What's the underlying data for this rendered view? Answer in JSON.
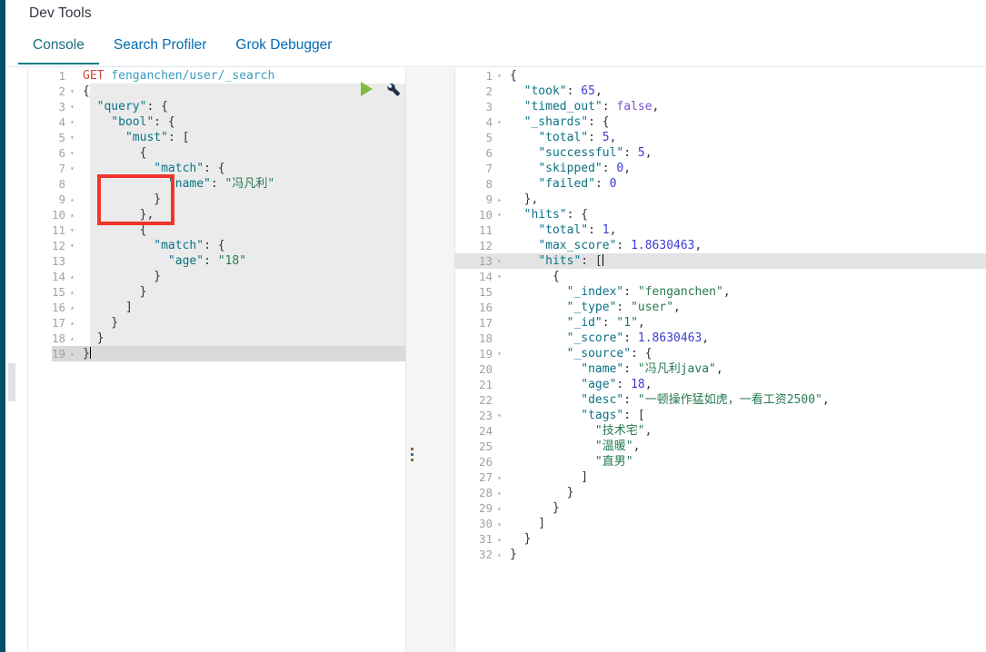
{
  "header": {
    "app_title": "Dev Tools",
    "tabs": [
      {
        "label": "Console",
        "active": true
      },
      {
        "label": "Search Profiler",
        "active": false
      },
      {
        "label": "Grok Debugger",
        "active": false
      }
    ]
  },
  "toolbar": {
    "run_icon": "play-icon",
    "wrench_icon": "wrench-icon"
  },
  "annotation": {
    "shape": "rectangle",
    "color": "#f2352c",
    "covers_lines": [
      3,
      4,
      5
    ]
  },
  "colors": {
    "rail": "#014f66",
    "tab_active_underline": "#017d87",
    "tab_link": "#006bb4",
    "editor_band": "#ebebeb",
    "active_line_left": "#d9d9d9",
    "active_line_right": "#e3e3e3",
    "key": "#0b7285",
    "string": "#267a52",
    "number": "#3b3bd4",
    "boolean": "#7a52d6",
    "method": "#d0463c",
    "url": "#3a9bbf",
    "play": "#7fbd42"
  },
  "request_editor": {
    "name": "console-request-editor",
    "active_line": 19,
    "lines": [
      {
        "n": 1,
        "fold": "",
        "tokens": [
          {
            "t": "GET ",
            "c": "method"
          },
          {
            "t": "fenganchen/user/_search",
            "c": "url"
          }
        ]
      },
      {
        "n": 2,
        "fold": "▾",
        "tokens": [
          {
            "t": "{",
            "c": "p"
          }
        ]
      },
      {
        "n": 3,
        "fold": "▾",
        "tokens": [
          {
            "t": "  ",
            "c": "p"
          },
          {
            "t": "\"query\"",
            "c": "k"
          },
          {
            "t": ": {",
            "c": "p"
          }
        ]
      },
      {
        "n": 4,
        "fold": "▾",
        "tokens": [
          {
            "t": "    ",
            "c": "p"
          },
          {
            "t": "\"bool\"",
            "c": "k"
          },
          {
            "t": ": {",
            "c": "p"
          }
        ]
      },
      {
        "n": 5,
        "fold": "▾",
        "tokens": [
          {
            "t": "      ",
            "c": "p"
          },
          {
            "t": "\"must\"",
            "c": "k"
          },
          {
            "t": ": [",
            "c": "p"
          }
        ]
      },
      {
        "n": 6,
        "fold": "▾",
        "tokens": [
          {
            "t": "        {",
            "c": "p"
          }
        ]
      },
      {
        "n": 7,
        "fold": "▾",
        "tokens": [
          {
            "t": "          ",
            "c": "p"
          },
          {
            "t": "\"match\"",
            "c": "k"
          },
          {
            "t": ": {",
            "c": "p"
          }
        ]
      },
      {
        "n": 8,
        "fold": "",
        "tokens": [
          {
            "t": "            ",
            "c": "p"
          },
          {
            "t": "\"name\"",
            "c": "k"
          },
          {
            "t": ": ",
            "c": "p"
          },
          {
            "t": "\"冯凡利\"",
            "c": "s"
          }
        ]
      },
      {
        "n": 9,
        "fold": "▴",
        "tokens": [
          {
            "t": "          }",
            "c": "p"
          }
        ]
      },
      {
        "n": 10,
        "fold": "▴",
        "tokens": [
          {
            "t": "        },",
            "c": "p"
          }
        ]
      },
      {
        "n": 11,
        "fold": "▾",
        "tokens": [
          {
            "t": "        {",
            "c": "p"
          }
        ]
      },
      {
        "n": 12,
        "fold": "▾",
        "tokens": [
          {
            "t": "          ",
            "c": "p"
          },
          {
            "t": "\"match\"",
            "c": "k"
          },
          {
            "t": ": {",
            "c": "p"
          }
        ]
      },
      {
        "n": 13,
        "fold": "",
        "tokens": [
          {
            "t": "            ",
            "c": "p"
          },
          {
            "t": "\"age\"",
            "c": "k"
          },
          {
            "t": ": ",
            "c": "p"
          },
          {
            "t": "\"18\"",
            "c": "s"
          }
        ]
      },
      {
        "n": 14,
        "fold": "▴",
        "tokens": [
          {
            "t": "          }",
            "c": "p"
          }
        ]
      },
      {
        "n": 15,
        "fold": "▴",
        "tokens": [
          {
            "t": "        }",
            "c": "p"
          }
        ]
      },
      {
        "n": 16,
        "fold": "▴",
        "tokens": [
          {
            "t": "      ]",
            "c": "p"
          }
        ]
      },
      {
        "n": 17,
        "fold": "▴",
        "tokens": [
          {
            "t": "    }",
            "c": "p"
          }
        ]
      },
      {
        "n": 18,
        "fold": "▴",
        "tokens": [
          {
            "t": "  }",
            "c": "p"
          }
        ]
      },
      {
        "n": 19,
        "fold": "▴",
        "tokens": [
          {
            "t": "}",
            "c": "p"
          }
        ],
        "caret": true
      }
    ]
  },
  "response_editor": {
    "name": "console-response-viewer",
    "active_line": 13,
    "lines": [
      {
        "n": 1,
        "fold": "▾",
        "tokens": [
          {
            "t": "{",
            "c": "p"
          }
        ]
      },
      {
        "n": 2,
        "fold": "",
        "tokens": [
          {
            "t": "  ",
            "c": "p"
          },
          {
            "t": "\"took\"",
            "c": "k"
          },
          {
            "t": ": ",
            "c": "p"
          },
          {
            "t": "65",
            "c": "n"
          },
          {
            "t": ",",
            "c": "p"
          }
        ]
      },
      {
        "n": 3,
        "fold": "",
        "tokens": [
          {
            "t": "  ",
            "c": "p"
          },
          {
            "t": "\"timed_out\"",
            "c": "k"
          },
          {
            "t": ": ",
            "c": "p"
          },
          {
            "t": "false",
            "c": "b"
          },
          {
            "t": ",",
            "c": "p"
          }
        ]
      },
      {
        "n": 4,
        "fold": "▾",
        "tokens": [
          {
            "t": "  ",
            "c": "p"
          },
          {
            "t": "\"_shards\"",
            "c": "k"
          },
          {
            "t": ": {",
            "c": "p"
          }
        ]
      },
      {
        "n": 5,
        "fold": "",
        "tokens": [
          {
            "t": "    ",
            "c": "p"
          },
          {
            "t": "\"total\"",
            "c": "k"
          },
          {
            "t": ": ",
            "c": "p"
          },
          {
            "t": "5",
            "c": "n"
          },
          {
            "t": ",",
            "c": "p"
          }
        ]
      },
      {
        "n": 6,
        "fold": "",
        "tokens": [
          {
            "t": "    ",
            "c": "p"
          },
          {
            "t": "\"successful\"",
            "c": "k"
          },
          {
            "t": ": ",
            "c": "p"
          },
          {
            "t": "5",
            "c": "n"
          },
          {
            "t": ",",
            "c": "p"
          }
        ]
      },
      {
        "n": 7,
        "fold": "",
        "tokens": [
          {
            "t": "    ",
            "c": "p"
          },
          {
            "t": "\"skipped\"",
            "c": "k"
          },
          {
            "t": ": ",
            "c": "p"
          },
          {
            "t": "0",
            "c": "n"
          },
          {
            "t": ",",
            "c": "p"
          }
        ]
      },
      {
        "n": 8,
        "fold": "",
        "tokens": [
          {
            "t": "    ",
            "c": "p"
          },
          {
            "t": "\"failed\"",
            "c": "k"
          },
          {
            "t": ": ",
            "c": "p"
          },
          {
            "t": "0",
            "c": "n"
          }
        ]
      },
      {
        "n": 9,
        "fold": "▴",
        "tokens": [
          {
            "t": "  },",
            "c": "p"
          }
        ]
      },
      {
        "n": 10,
        "fold": "▾",
        "tokens": [
          {
            "t": "  ",
            "c": "p"
          },
          {
            "t": "\"hits\"",
            "c": "k"
          },
          {
            "t": ": {",
            "c": "p"
          }
        ]
      },
      {
        "n": 11,
        "fold": "",
        "tokens": [
          {
            "t": "    ",
            "c": "p"
          },
          {
            "t": "\"total\"",
            "c": "k"
          },
          {
            "t": ": ",
            "c": "p"
          },
          {
            "t": "1",
            "c": "n"
          },
          {
            "t": ",",
            "c": "p"
          }
        ]
      },
      {
        "n": 12,
        "fold": "",
        "tokens": [
          {
            "t": "    ",
            "c": "p"
          },
          {
            "t": "\"max_score\"",
            "c": "k"
          },
          {
            "t": ": ",
            "c": "p"
          },
          {
            "t": "1.8630463",
            "c": "n"
          },
          {
            "t": ",",
            "c": "p"
          }
        ]
      },
      {
        "n": 13,
        "fold": "▾",
        "tokens": [
          {
            "t": "    ",
            "c": "p"
          },
          {
            "t": "\"hits\"",
            "c": "k"
          },
          {
            "t": ": [",
            "c": "p"
          }
        ],
        "caret": true
      },
      {
        "n": 14,
        "fold": "▾",
        "tokens": [
          {
            "t": "      {",
            "c": "p"
          }
        ]
      },
      {
        "n": 15,
        "fold": "",
        "tokens": [
          {
            "t": "        ",
            "c": "p"
          },
          {
            "t": "\"_index\"",
            "c": "k"
          },
          {
            "t": ": ",
            "c": "p"
          },
          {
            "t": "\"fenganchen\"",
            "c": "s"
          },
          {
            "t": ",",
            "c": "p"
          }
        ]
      },
      {
        "n": 16,
        "fold": "",
        "tokens": [
          {
            "t": "        ",
            "c": "p"
          },
          {
            "t": "\"_type\"",
            "c": "k"
          },
          {
            "t": ": ",
            "c": "p"
          },
          {
            "t": "\"user\"",
            "c": "s"
          },
          {
            "t": ",",
            "c": "p"
          }
        ]
      },
      {
        "n": 17,
        "fold": "",
        "tokens": [
          {
            "t": "        ",
            "c": "p"
          },
          {
            "t": "\"_id\"",
            "c": "k"
          },
          {
            "t": ": ",
            "c": "p"
          },
          {
            "t": "\"1\"",
            "c": "s"
          },
          {
            "t": ",",
            "c": "p"
          }
        ]
      },
      {
        "n": 18,
        "fold": "",
        "tokens": [
          {
            "t": "        ",
            "c": "p"
          },
          {
            "t": "\"_score\"",
            "c": "k"
          },
          {
            "t": ": ",
            "c": "p"
          },
          {
            "t": "1.8630463",
            "c": "n"
          },
          {
            "t": ",",
            "c": "p"
          }
        ]
      },
      {
        "n": 19,
        "fold": "▾",
        "tokens": [
          {
            "t": "        ",
            "c": "p"
          },
          {
            "t": "\"_source\"",
            "c": "k"
          },
          {
            "t": ": {",
            "c": "p"
          }
        ]
      },
      {
        "n": 20,
        "fold": "",
        "tokens": [
          {
            "t": "          ",
            "c": "p"
          },
          {
            "t": "\"name\"",
            "c": "k"
          },
          {
            "t": ": ",
            "c": "p"
          },
          {
            "t": "\"冯凡利java\"",
            "c": "s"
          },
          {
            "t": ",",
            "c": "p"
          }
        ]
      },
      {
        "n": 21,
        "fold": "",
        "tokens": [
          {
            "t": "          ",
            "c": "p"
          },
          {
            "t": "\"age\"",
            "c": "k"
          },
          {
            "t": ": ",
            "c": "p"
          },
          {
            "t": "18",
            "c": "n"
          },
          {
            "t": ",",
            "c": "p"
          }
        ]
      },
      {
        "n": 22,
        "fold": "",
        "tokens": [
          {
            "t": "          ",
            "c": "p"
          },
          {
            "t": "\"desc\"",
            "c": "k"
          },
          {
            "t": ": ",
            "c": "p"
          },
          {
            "t": "\"一顿操作猛如虎，一看工资2500\"",
            "c": "s"
          },
          {
            "t": ",",
            "c": "p"
          }
        ]
      },
      {
        "n": 23,
        "fold": "▾",
        "tokens": [
          {
            "t": "          ",
            "c": "p"
          },
          {
            "t": "\"tags\"",
            "c": "k"
          },
          {
            "t": ": [",
            "c": "p"
          }
        ]
      },
      {
        "n": 24,
        "fold": "",
        "tokens": [
          {
            "t": "            ",
            "c": "p"
          },
          {
            "t": "\"技术宅\"",
            "c": "s"
          },
          {
            "t": ",",
            "c": "p"
          }
        ]
      },
      {
        "n": 25,
        "fold": "",
        "tokens": [
          {
            "t": "            ",
            "c": "p"
          },
          {
            "t": "\"温暖\"",
            "c": "s"
          },
          {
            "t": ",",
            "c": "p"
          }
        ]
      },
      {
        "n": 26,
        "fold": "",
        "tokens": [
          {
            "t": "            ",
            "c": "p"
          },
          {
            "t": "\"直男\"",
            "c": "s"
          }
        ]
      },
      {
        "n": 27,
        "fold": "▴",
        "tokens": [
          {
            "t": "          ]",
            "c": "p"
          }
        ]
      },
      {
        "n": 28,
        "fold": "▴",
        "tokens": [
          {
            "t": "        }",
            "c": "p"
          }
        ]
      },
      {
        "n": 29,
        "fold": "▴",
        "tokens": [
          {
            "t": "      }",
            "c": "p"
          }
        ]
      },
      {
        "n": 30,
        "fold": "▴",
        "tokens": [
          {
            "t": "    ]",
            "c": "p"
          }
        ]
      },
      {
        "n": 31,
        "fold": "▴",
        "tokens": [
          {
            "t": "  }",
            "c": "p"
          }
        ]
      },
      {
        "n": 32,
        "fold": "▴",
        "tokens": [
          {
            "t": "}",
            "c": "p"
          }
        ]
      }
    ]
  },
  "splitter": {
    "name": "pane-splitter",
    "dots": 3
  }
}
